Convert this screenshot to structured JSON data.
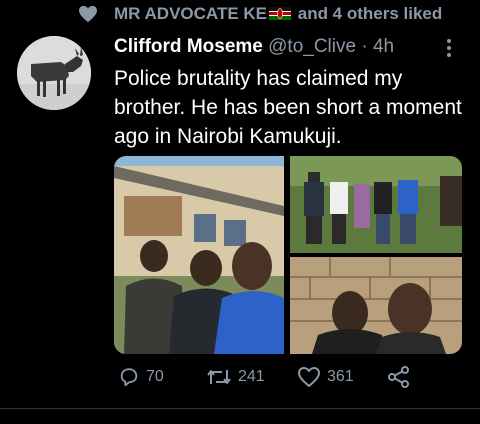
{
  "liked_banner": {
    "prefix": "MR ADVOCATE KE",
    "suffix": "and 4 others liked",
    "icon": "heart-icon"
  },
  "tweet": {
    "author_name": "Clifford Moseme",
    "handle": "@to_Clive",
    "separator": "·",
    "time": "4h",
    "text": "Police brutality has claimed my brother. He has been short a moment ago in Nairobi Kamukuji.",
    "media_count": 3
  },
  "actions": {
    "reply_count": "70",
    "retweet_count": "241",
    "like_count": "361"
  },
  "colors": {
    "background": "#000000",
    "secondary_text": "#8b98a5",
    "divider": "#2f3336"
  }
}
